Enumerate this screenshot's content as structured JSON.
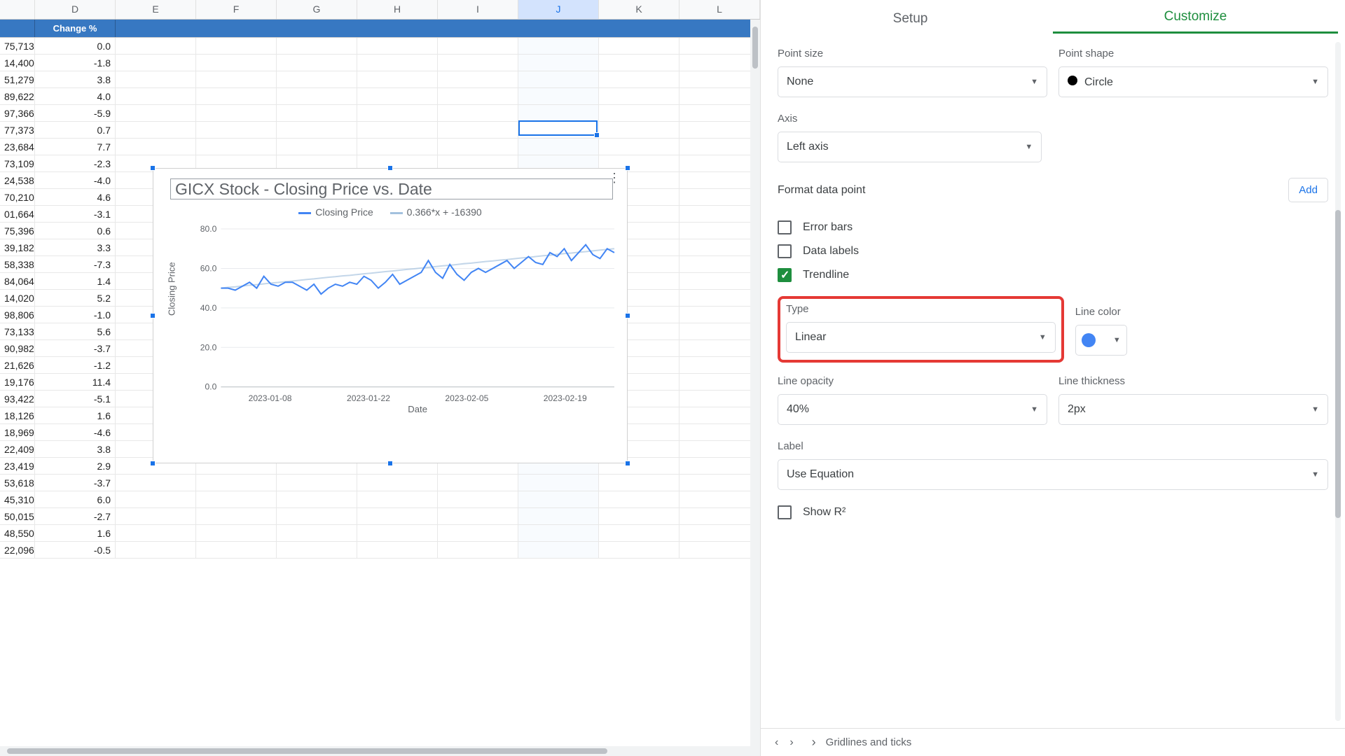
{
  "columns": [
    "D",
    "E",
    "F",
    "G",
    "H",
    "I",
    "J",
    "K",
    "L"
  ],
  "selected_col": "J",
  "header_row": {
    "label": "Change %"
  },
  "rows": [
    {
      "v": "75,713",
      "c": "0.0"
    },
    {
      "v": "14,400",
      "c": "-1.8"
    },
    {
      "v": "51,279",
      "c": "3.8"
    },
    {
      "v": "89,622",
      "c": "4.0"
    },
    {
      "v": "97,366",
      "c": "-5.9"
    },
    {
      "v": "77,373",
      "c": "0.7"
    },
    {
      "v": "23,684",
      "c": "7.7"
    },
    {
      "v": "73,109",
      "c": "-2.3"
    },
    {
      "v": "24,538",
      "c": "-4.0"
    },
    {
      "v": "70,210",
      "c": "4.6"
    },
    {
      "v": "01,664",
      "c": "-3.1"
    },
    {
      "v": "75,396",
      "c": "0.6"
    },
    {
      "v": "39,182",
      "c": "3.3"
    },
    {
      "v": "58,338",
      "c": "-7.3"
    },
    {
      "v": "84,064",
      "c": "1.4"
    },
    {
      "v": "14,020",
      "c": "5.2"
    },
    {
      "v": "98,806",
      "c": "-1.0"
    },
    {
      "v": "73,133",
      "c": "5.6"
    },
    {
      "v": "90,982",
      "c": "-3.7"
    },
    {
      "v": "21,626",
      "c": "-1.2"
    },
    {
      "v": "19,176",
      "c": "11.4"
    },
    {
      "v": "93,422",
      "c": "-5.1"
    },
    {
      "v": "18,126",
      "c": "1.6"
    },
    {
      "v": "18,969",
      "c": "-4.6"
    },
    {
      "v": "22,409",
      "c": "3.8"
    },
    {
      "v": "23,419",
      "c": "2.9"
    },
    {
      "v": "53,618",
      "c": "-3.7"
    },
    {
      "v": "45,310",
      "c": "6.0"
    },
    {
      "v": "50,015",
      "c": "-2.7"
    },
    {
      "v": "48,550",
      "c": "1.6"
    },
    {
      "v": "22,096",
      "c": "-0.5"
    }
  ],
  "chart": {
    "title": "GICX Stock - Closing Price vs. Date",
    "legend_series": "Closing Price",
    "legend_trend": "0.366*x + -16390",
    "xlabel": "Date",
    "ylabel": "Closing Price",
    "x_ticks": [
      "2023-01-08",
      "2023-01-22",
      "2023-02-05",
      "2023-02-19"
    ],
    "y_ticks": [
      "0.0",
      "20.0",
      "40.0",
      "60.0",
      "80.0"
    ]
  },
  "chart_data": {
    "type": "line",
    "title": "GICX Stock - Closing Price vs. Date",
    "xlabel": "Date",
    "ylabel": "Closing Price",
    "ylim": [
      0,
      80
    ],
    "x": [
      0,
      1,
      2,
      3,
      4,
      5,
      6,
      7,
      8,
      9,
      10,
      11,
      12,
      13,
      14,
      15,
      16,
      17,
      18,
      19,
      20,
      21,
      22,
      23,
      24,
      25,
      26,
      27,
      28,
      29,
      30,
      31,
      32,
      33,
      34,
      35,
      36,
      37,
      38,
      39,
      40,
      41,
      42,
      43,
      44,
      45,
      46,
      47,
      48,
      49,
      50,
      51,
      52,
      53,
      54,
      55
    ],
    "series": [
      {
        "name": "Closing Price",
        "values": [
          50,
          50,
          49,
          51,
          53,
          50,
          56,
          52,
          51,
          53,
          53,
          51,
          49,
          52,
          47,
          50,
          52,
          51,
          53,
          52,
          56,
          54,
          50,
          53,
          57,
          52,
          54,
          56,
          58,
          64,
          58,
          55,
          62,
          57,
          54,
          58,
          60,
          58,
          60,
          62,
          64,
          60,
          63,
          66,
          63,
          62,
          68,
          66,
          70,
          64,
          68,
          72,
          67,
          65,
          70,
          68
        ]
      },
      {
        "name": "0.366*x + -16390",
        "values": [
          50,
          50.4,
          50.7,
          51.1,
          51.5,
          51.8,
          52.2,
          52.6,
          52.9,
          53.3,
          53.6,
          54,
          54.4,
          54.7,
          55.1,
          55.5,
          55.8,
          56.2,
          56.5,
          56.9,
          57.3,
          57.6,
          58,
          58.4,
          58.7,
          59.1,
          59.5,
          59.8,
          60.2,
          60.5,
          60.9,
          61.3,
          61.6,
          62,
          62.4,
          62.7,
          63.1,
          63.5,
          63.8,
          64.2,
          64.5,
          64.9,
          65.3,
          65.6,
          66,
          66.4,
          66.7,
          67.1,
          67.5,
          67.8,
          68.2,
          68.5,
          68.9,
          69.3,
          69.6,
          70
        ]
      }
    ],
    "x_tick_labels": [
      "2023-01-08",
      "2023-01-22",
      "2023-02-05",
      "2023-02-19"
    ]
  },
  "sidebar": {
    "tabs": {
      "setup": "Setup",
      "customize": "Customize"
    },
    "point_size_label": "Point size",
    "point_size_value": "None",
    "point_shape_label": "Point shape",
    "point_shape_value": "Circle",
    "axis_label": "Axis",
    "axis_value": "Left axis",
    "format_dp_label": "Format data point",
    "add_btn": "Add",
    "cb_error": "Error bars",
    "cb_datalabels": "Data labels",
    "cb_trendline": "Trendline",
    "type_label": "Type",
    "type_value": "Linear",
    "linecolor_label": "Line color",
    "lineopacity_label": "Line opacity",
    "lineopacity_value": "40%",
    "linethick_label": "Line thickness",
    "linethick_value": "2px",
    "label_label": "Label",
    "label_value": "Use Equation",
    "show_r2": "Show R²",
    "footer": "Gridlines and ticks"
  }
}
